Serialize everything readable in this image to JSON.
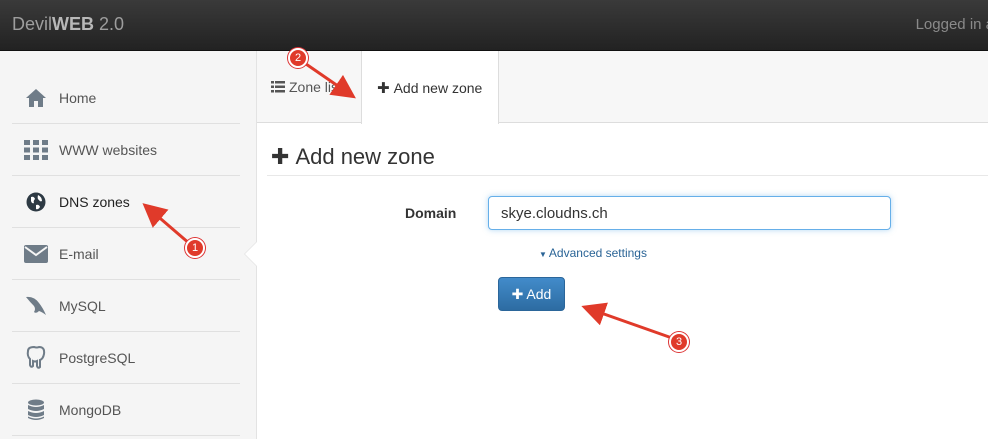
{
  "app": {
    "brand_light": "Devil",
    "brand_bold": "WEB",
    "brand_version": " 2.0",
    "login_text": "Logged in a"
  },
  "sidebar": {
    "items": [
      {
        "label": "Home",
        "icon": "home-icon"
      },
      {
        "label": "WWW websites",
        "icon": "grid-icon"
      },
      {
        "label": "DNS zones",
        "icon": "globe-icon"
      },
      {
        "label": "E-mail",
        "icon": "envelope-icon"
      },
      {
        "label": "MySQL",
        "icon": "dolphin-icon"
      },
      {
        "label": "PostgreSQL",
        "icon": "elephant-icon"
      },
      {
        "label": "MongoDB",
        "icon": "database-icon"
      }
    ],
    "active_index": 2
  },
  "tabs": [
    {
      "label": "Zone list",
      "icon": "list-icon"
    },
    {
      "label": "Add new zone",
      "icon": "plus-icon"
    }
  ],
  "form": {
    "heading": "Add new zone",
    "domain_label": "Domain",
    "domain_value": "skye.cloudns.ch",
    "advanced_label": "Advanced settings",
    "add_button_label": "Add"
  },
  "annotations": [
    {
      "number": "1"
    },
    {
      "number": "2"
    },
    {
      "number": "3"
    }
  ],
  "colors": {
    "accent": "#428bca",
    "annotation_red": "#e03a2a",
    "topbar": "#2b2b2b"
  }
}
